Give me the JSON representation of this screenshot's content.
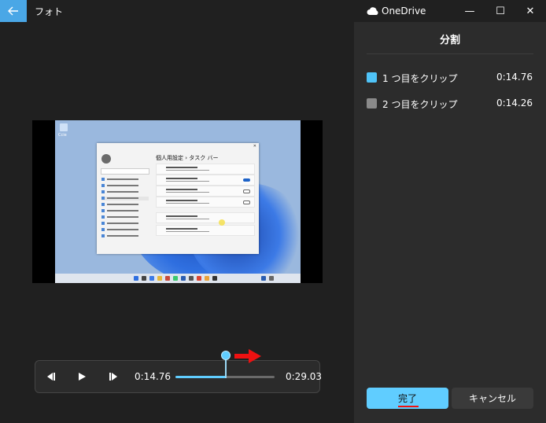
{
  "app": {
    "title": "フォト"
  },
  "video": {
    "desktop_icon_label": "Ccie",
    "settings_title": "個人用設定 › タスク バー"
  },
  "playback": {
    "current_time": "0:14.76",
    "total_time": "0:29.03",
    "progress": 0.508
  },
  "window": {
    "onedrive_label": "OneDrive",
    "minimize": "—",
    "maximize": "☐",
    "close": "✕"
  },
  "panel": {
    "title": "分割",
    "clips": [
      {
        "name": "1 つ目をクリップ",
        "duration": "0:14.76",
        "color": "#4fc3f7"
      },
      {
        "name": "2 つ目をクリップ",
        "duration": "0:14.26",
        "color": "#8a8a8a"
      }
    ],
    "done_label": "完了",
    "cancel_label": "キャンセル"
  },
  "colors": {
    "accent": "#60cdff",
    "annotation": "#e11111"
  }
}
